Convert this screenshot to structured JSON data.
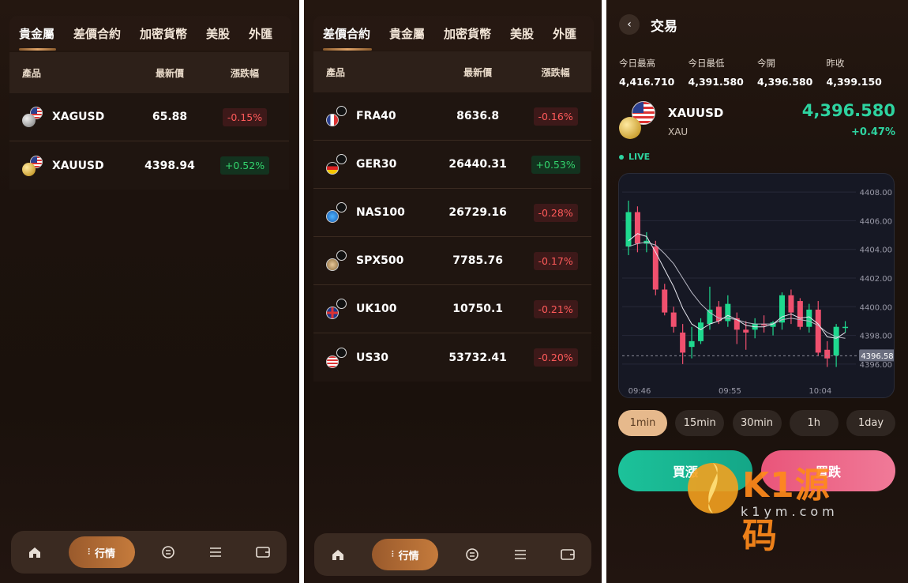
{
  "panel1": {
    "tabs": [
      "貴金屬",
      "差價合約",
      "加密貨幣",
      "美股",
      "外匯"
    ],
    "active_tab": 0,
    "header": {
      "product": "產品",
      "price": "最新價",
      "change": "漲跌幅"
    },
    "rows": [
      {
        "symbol": "XAGUSD",
        "price": "65.88",
        "change": "-0.15%",
        "dir": "down",
        "flag": "us",
        "coin": "silver"
      },
      {
        "symbol": "XAUUSD",
        "price": "4398.94",
        "change": "+0.52%",
        "dir": "up",
        "flag": "us",
        "coin": "gold"
      }
    ]
  },
  "panel2": {
    "tabs": [
      "差價合約",
      "貴金屬",
      "加密貨幣",
      "美股",
      "外匯"
    ],
    "active_tab": 0,
    "header": {
      "product": "產品",
      "price": "最新價",
      "change": "漲跌幅"
    },
    "rows": [
      {
        "symbol": "FRA40",
        "price": "8636.8",
        "change": "-0.16%",
        "dir": "down",
        "flag": "fr"
      },
      {
        "symbol": "GER30",
        "price": "26440.31",
        "change": "+0.53%",
        "dir": "up",
        "flag": "de"
      },
      {
        "symbol": "NAS100",
        "price": "26729.16",
        "change": "-0.28%",
        "dir": "down",
        "flag": "nas"
      },
      {
        "symbol": "SPX500",
        "price": "7785.76",
        "change": "-0.17%",
        "dir": "down",
        "flag": "spx"
      },
      {
        "symbol": "UK100",
        "price": "10750.1",
        "change": "-0.21%",
        "dir": "down",
        "flag": "uk"
      },
      {
        "symbol": "US30",
        "price": "53732.41",
        "change": "-0.20%",
        "dir": "down",
        "flag": "us"
      }
    ]
  },
  "nav": {
    "active_label": "行情",
    "items": [
      "home-icon",
      "market-icon",
      "exchange-icon",
      "list-icon",
      "wallet-icon"
    ]
  },
  "trade": {
    "title": "交易",
    "stats": [
      {
        "label": "今日最高",
        "value": "4,416.710"
      },
      {
        "label": "今日最低",
        "value": "4,391.580"
      },
      {
        "label": "今開",
        "value": "4,396.580"
      },
      {
        "label": "昨收",
        "value": "4,399.150"
      }
    ],
    "symbol": "XAUUSD",
    "sub": "XAU",
    "price": "4,396.580",
    "change": "+0.47%",
    "live": "LIVE",
    "timeframes": [
      "1min",
      "15min",
      "30min",
      "1h",
      "1day"
    ],
    "active_timeframe": 0,
    "buy_label": "買漲",
    "sell_label": "買跌",
    "watermark": {
      "text": "K1源码",
      "url": "k1ym.com"
    }
  },
  "chart_data": {
    "type": "candlestick",
    "y_ticks": [
      "4408.00",
      "4406.00",
      "4404.00",
      "4402.00",
      "4400.00",
      "4398.00",
      "4396.00"
    ],
    "ylim": [
      4395.5,
      4408.5
    ],
    "x_ticks": [
      "09:46",
      "09:55",
      "10:04"
    ],
    "current_price_label": "4396.58",
    "current_price": 4396.58,
    "candles": [
      {
        "o": 4404.2,
        "h": 4407.4,
        "l": 4403.6,
        "c": 4406.6
      },
      {
        "o": 4406.6,
        "h": 4407.0,
        "l": 4403.8,
        "c": 4404.4
      },
      {
        "o": 4404.4,
        "h": 4405.2,
        "l": 4403.8,
        "c": 4404.6
      },
      {
        "o": 4404.2,
        "h": 4404.6,
        "l": 4400.8,
        "c": 4401.2
      },
      {
        "o": 4401.2,
        "h": 4401.6,
        "l": 4399.4,
        "c": 4399.6
      },
      {
        "o": 4399.6,
        "h": 4400.0,
        "l": 4398.2,
        "c": 4398.6
      },
      {
        "o": 4398.2,
        "h": 4398.8,
        "l": 4396.0,
        "c": 4396.8
      },
      {
        "o": 4397.2,
        "h": 4398.6,
        "l": 4396.4,
        "c": 4397.6
      },
      {
        "o": 4397.6,
        "h": 4399.2,
        "l": 4397.4,
        "c": 4398.9
      },
      {
        "o": 4398.8,
        "h": 4401.4,
        "l": 4398.4,
        "c": 4399.8
      },
      {
        "o": 4400.0,
        "h": 4400.4,
        "l": 4398.8,
        "c": 4399.0
      },
      {
        "o": 4399.0,
        "h": 4400.8,
        "l": 4398.6,
        "c": 4400.2
      },
      {
        "o": 4399.2,
        "h": 4399.6,
        "l": 4397.4,
        "c": 4398.4
      },
      {
        "o": 4398.4,
        "h": 4399.0,
        "l": 4397.0,
        "c": 4398.2
      },
      {
        "o": 4398.4,
        "h": 4399.2,
        "l": 4397.8,
        "c": 4398.8
      },
      {
        "o": 4398.8,
        "h": 4399.4,
        "l": 4398.2,
        "c": 4398.7
      },
      {
        "o": 4398.6,
        "h": 4399.0,
        "l": 4398.0,
        "c": 4398.9
      },
      {
        "o": 4398.9,
        "h": 4401.0,
        "l": 4398.4,
        "c": 4400.8
      },
      {
        "o": 4400.8,
        "h": 4401.2,
        "l": 4398.8,
        "c": 4399.6
      },
      {
        "o": 4400.4,
        "h": 4400.6,
        "l": 4398.4,
        "c": 4398.6
      },
      {
        "o": 4398.6,
        "h": 4400.2,
        "l": 4398.2,
        "c": 4399.8
      },
      {
        "o": 4399.8,
        "h": 4400.4,
        "l": 4396.6,
        "c": 4396.8
      },
      {
        "o": 4397.0,
        "h": 4397.6,
        "l": 4395.8,
        "c": 4396.4
      },
      {
        "o": 4396.6,
        "h": 4398.8,
        "l": 4395.8,
        "c": 4398.6
      },
      {
        "o": 4398.6,
        "h": 4399.0,
        "l": 4398.2,
        "c": 4398.6
      }
    ],
    "ma_short": [
      4404.6,
      4405.1,
      4404.9,
      4403.8,
      4402.6,
      4401.4,
      4399.9,
      4398.8,
      4398.4,
      4398.8,
      4399.0,
      4399.4,
      4399.1,
      4398.7,
      4398.6,
      4398.6,
      4398.8,
      4399.3,
      4399.5,
      4399.2,
      4399.3,
      4398.8,
      4397.9,
      4397.8,
      4398.2
    ],
    "ma_long": [
      4404.2,
      4404.4,
      4404.5,
      4404.3,
      4403.7,
      4403.0,
      4402.0,
      4401.0,
      4400.2,
      4399.6,
      4399.2,
      4399.2,
      4399.1,
      4398.9,
      4398.8,
      4398.8,
      4398.8,
      4399.1,
      4399.2,
      4399.1,
      4399.0,
      4398.7,
      4398.2,
      4397.9,
      4397.8
    ]
  }
}
